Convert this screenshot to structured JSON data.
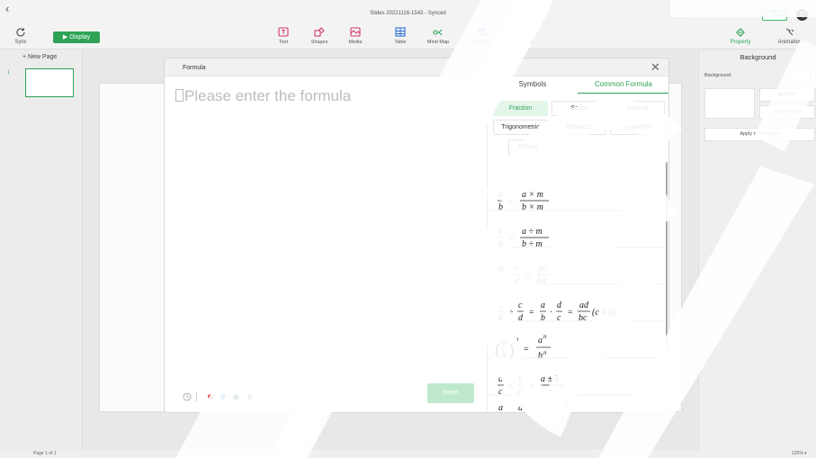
{
  "window": {
    "title": "Slides 20221116-1543 - Synced",
    "back_icon": "chevron-left-icon"
  },
  "header": {
    "share_label": "Share",
    "user_initial": "Q",
    "sync_label": "Sync",
    "display_label": "Display",
    "tools": [
      {
        "label": "Text",
        "icon": "text-box-icon"
      },
      {
        "label": "Shapes",
        "icon": "shapes-icon"
      },
      {
        "label": "Media",
        "icon": "media-icon"
      },
      {
        "label": "Table",
        "icon": "table-icon"
      },
      {
        "label": "Mind Map",
        "icon": "mind-map-icon"
      },
      {
        "label": "Activity",
        "icon": "activity-icon"
      },
      {
        "label": "Subjects",
        "icon": "subjects-icon"
      }
    ],
    "right_tools": [
      {
        "label": "Property",
        "icon": "property-icon"
      },
      {
        "label": "Animation",
        "icon": "animation-icon"
      }
    ]
  },
  "left_panel": {
    "new_page_label": "+ New Page",
    "page_number": "1"
  },
  "right_panel": {
    "title": "Background",
    "background_label": "Background",
    "more_label": "More",
    "local_picture_label": "Local Picture",
    "apply_all_label": "Apply to All Pages"
  },
  "status": {
    "page_info": "Page 1 of 1",
    "zoom": "125%"
  },
  "dialog": {
    "title": "Formula",
    "placeholder": "Please enter the formula",
    "tabs": [
      "Symbols",
      "Common Formula"
    ],
    "active_tab": "Common Formula",
    "categories": [
      "Fraction",
      "Script",
      "Radical",
      "Trigonometric",
      "Brackets",
      "Logarithm",
      "Others"
    ],
    "active_category": "Fraction",
    "insert_label": "Insert",
    "colors": [
      "#e0242f",
      "#1c7fe0",
      "#1a1a1a",
      "#2ea356",
      "#f5a623"
    ],
    "accent": "#2ea356"
  },
  "formulas": [
    {
      "name": "formula-fraction-multiply"
    },
    {
      "name": "formula-fraction-divide"
    },
    {
      "name": "formula-fraction-product"
    },
    {
      "name": "formula-fraction-quotient"
    },
    {
      "name": "formula-fraction-power"
    },
    {
      "name": "formula-fraction-same-denominator"
    },
    {
      "name": "formula-fraction-cross-add"
    }
  ]
}
